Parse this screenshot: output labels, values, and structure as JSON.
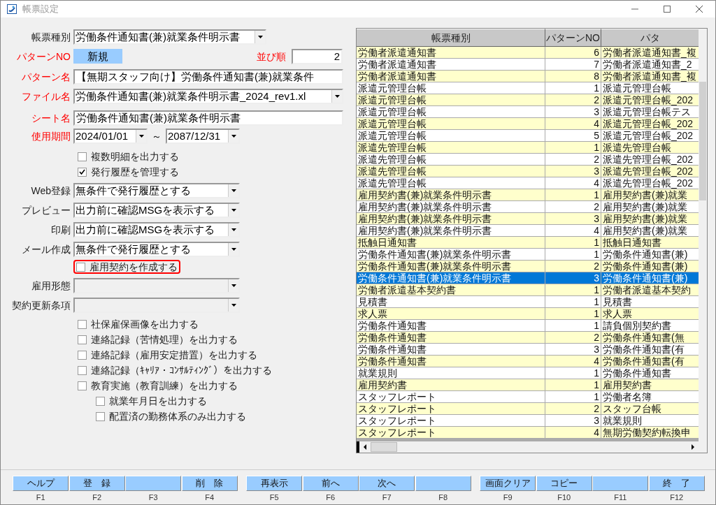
{
  "window": {
    "title": "帳票設定"
  },
  "form": {
    "form_type": {
      "label": "帳票種別",
      "required": false,
      "value": "労働条件通知書(兼)就業条件明示書"
    },
    "pattern_no": {
      "label": "パターンNO",
      "required": true,
      "value": "新規"
    },
    "sort_order": {
      "label": "並び順",
      "required": true,
      "value": "2"
    },
    "pattern_name": {
      "label": "パターン名",
      "required": true,
      "value": "【無期スタッフ向け】労働条件通知書(兼)就業条件"
    },
    "file_name": {
      "label": "ファイル名",
      "required": true,
      "value": "労働条件通知書(兼)就業条件明示書_2024_rev1.xl"
    },
    "sheet_name": {
      "label": "シート名",
      "required": true,
      "value": "労働条件通知書(兼)就業条件明示書"
    },
    "period": {
      "label": "使用期間",
      "required": true,
      "from": "2024/01/01",
      "separator": "～",
      "to": "2087/12/31"
    },
    "top_checks": [
      {
        "label": "複数明細を出力する",
        "checked": false
      },
      {
        "label": "発行履歴を管理する",
        "checked": true
      }
    ],
    "settings": [
      {
        "label": "Web登録",
        "required": false,
        "disabled": false,
        "value": "無条件で発行履歴とする"
      },
      {
        "label": "プレビュー",
        "required": false,
        "disabled": false,
        "value": "出力前に確認MSGを表示する"
      },
      {
        "label": "印刷",
        "required": false,
        "disabled": false,
        "value": "出力前に確認MSGを表示する"
      },
      {
        "label": "メール作成",
        "required": false,
        "disabled": false,
        "value": "無条件で発行履歴とする"
      }
    ],
    "contract_check": {
      "label": "雇用契約を作成する",
      "checked": false,
      "highlighted": true
    },
    "contract_settings": [
      {
        "label": "雇用形態",
        "required": false,
        "disabled": true
      },
      {
        "label": "契約更新条項",
        "required": false,
        "disabled": true
      }
    ],
    "output_checks": [
      {
        "label": "社保雇保画像を出力する",
        "checked": false
      },
      {
        "label": "連絡記録（苦情処理）を出力する",
        "checked": false
      },
      {
        "label": "連絡記録（雇用安定措置）を出力する",
        "checked": false
      },
      {
        "label": "連絡記録（ｷｬﾘｱ・ｺﾝｻﾙﾃｨﾝｸﾞ）を出力する",
        "checked": false
      },
      {
        "label": "教育実施（教育訓練）を出力する",
        "checked": false,
        "children": [
          {
            "label": "就業年月日を出力する",
            "checked": false
          },
          {
            "label": "配置済の勤務体系のみ出力する",
            "checked": false
          }
        ]
      }
    ]
  },
  "table": {
    "columns": [
      "帳票種別",
      "パターンNO",
      "パタ"
    ],
    "rows": [
      {
        "cells": [
          "労働者派遣通知書",
          "6",
          "労働者派遣通知書_複"
        ],
        "selected": false
      },
      {
        "cells": [
          "労働者派遣通知書",
          "7",
          "労働者派遣通知書_2"
        ],
        "selected": false
      },
      {
        "cells": [
          "労働者派遣通知書",
          "8",
          "労働者派遣通知書_複"
        ],
        "selected": false
      },
      {
        "cells": [
          "派遣元管理台帳",
          "1",
          "派遣元管理台帳"
        ],
        "selected": false
      },
      {
        "cells": [
          "派遣元管理台帳",
          "2",
          "派遣元管理台帳_202"
        ],
        "selected": false
      },
      {
        "cells": [
          "派遣元管理台帳",
          "3",
          "派遣元管理台帳テス"
        ],
        "selected": false
      },
      {
        "cells": [
          "派遣元管理台帳",
          "4",
          "派遣元管理台帳_202"
        ],
        "selected": false
      },
      {
        "cells": [
          "派遣元管理台帳",
          "5",
          "派遣元管理台帳_202"
        ],
        "selected": false
      },
      {
        "cells": [
          "派遣先管理台帳",
          "1",
          "派遣先管理台帳"
        ],
        "selected": false
      },
      {
        "cells": [
          "派遣先管理台帳",
          "2",
          "派遣先管理台帳_202"
        ],
        "selected": false
      },
      {
        "cells": [
          "派遣先管理台帳",
          "3",
          "派遣先管理台帳_202"
        ],
        "selected": false
      },
      {
        "cells": [
          "派遣先管理台帳",
          "4",
          "派遣先管理台帳_202"
        ],
        "selected": false
      },
      {
        "cells": [
          "雇用契約書(兼)就業条件明示書",
          "1",
          "雇用契約書(兼)就業"
        ],
        "selected": false
      },
      {
        "cells": [
          "雇用契約書(兼)就業条件明示書",
          "2",
          "雇用契約書(兼)就業"
        ],
        "selected": false
      },
      {
        "cells": [
          "雇用契約書(兼)就業条件明示書",
          "3",
          "雇用契約書(兼)就業"
        ],
        "selected": false
      },
      {
        "cells": [
          "雇用契約書(兼)就業条件明示書",
          "4",
          "雇用契約書(兼)就業"
        ],
        "selected": false
      },
      {
        "cells": [
          "抵触日通知書",
          "1",
          "抵触日通知書"
        ],
        "selected": false
      },
      {
        "cells": [
          "労働条件通知書(兼)就業条件明示書",
          "1",
          "労働条件通知書(兼)"
        ],
        "selected": false
      },
      {
        "cells": [
          "労働条件通知書(兼)就業条件明示書",
          "2",
          "労働条件通知書(兼)"
        ],
        "selected": false
      },
      {
        "cells": [
          "労働条件通知書(兼)就業条件明示書",
          "3",
          "労働条件通知書(兼)"
        ],
        "selected": true
      },
      {
        "cells": [
          "労働者派遣基本契約書",
          "1",
          "労働者派遣基本契約"
        ],
        "selected": false
      },
      {
        "cells": [
          "見積書",
          "1",
          "見積書"
        ],
        "selected": false
      },
      {
        "cells": [
          "求人票",
          "1",
          "求人票"
        ],
        "selected": false
      },
      {
        "cells": [
          "労働条件通知書",
          "1",
          "請負個別契約書"
        ],
        "selected": false
      },
      {
        "cells": [
          "労働条件通知書",
          "2",
          "労働条件通知書(無"
        ],
        "selected": false
      },
      {
        "cells": [
          "労働条件通知書",
          "3",
          "労働条件通知書(有"
        ],
        "selected": false
      },
      {
        "cells": [
          "労働条件通知書",
          "4",
          "労働条件通知書(有"
        ],
        "selected": false
      },
      {
        "cells": [
          "就業規則",
          "1",
          "労働条件通知書"
        ],
        "selected": false
      },
      {
        "cells": [
          "雇用契約書",
          "1",
          "雇用契約書"
        ],
        "selected": false
      },
      {
        "cells": [
          "スタッフレポート",
          "1",
          "労働者名簿"
        ],
        "selected": false
      },
      {
        "cells": [
          "スタッフレポート",
          "2",
          "スタッフ台帳"
        ],
        "selected": false
      },
      {
        "cells": [
          "スタッフレポート",
          "3",
          "就業規則"
        ],
        "selected": false
      },
      {
        "cells": [
          "スタッフレポート",
          "4",
          "無期労働契約転換申"
        ],
        "selected": false
      }
    ]
  },
  "function_keys": [
    {
      "label": "ヘルプ",
      "key": "F1"
    },
    {
      "label": "登　録",
      "key": "F2"
    },
    {
      "key": "F3"
    },
    {
      "label": "削　除",
      "key": "F4"
    },
    {
      "label": "再表示",
      "key": "F5"
    },
    {
      "label": "前へ",
      "key": "F6"
    },
    {
      "label": "次へ",
      "key": "F7"
    },
    {
      "key": "F8"
    },
    {
      "label": "画面クリア",
      "key": "F9"
    },
    {
      "label": "コピー",
      "key": "F10"
    },
    {
      "key": "F11"
    },
    {
      "label": "終　了",
      "key": "F12"
    }
  ]
}
